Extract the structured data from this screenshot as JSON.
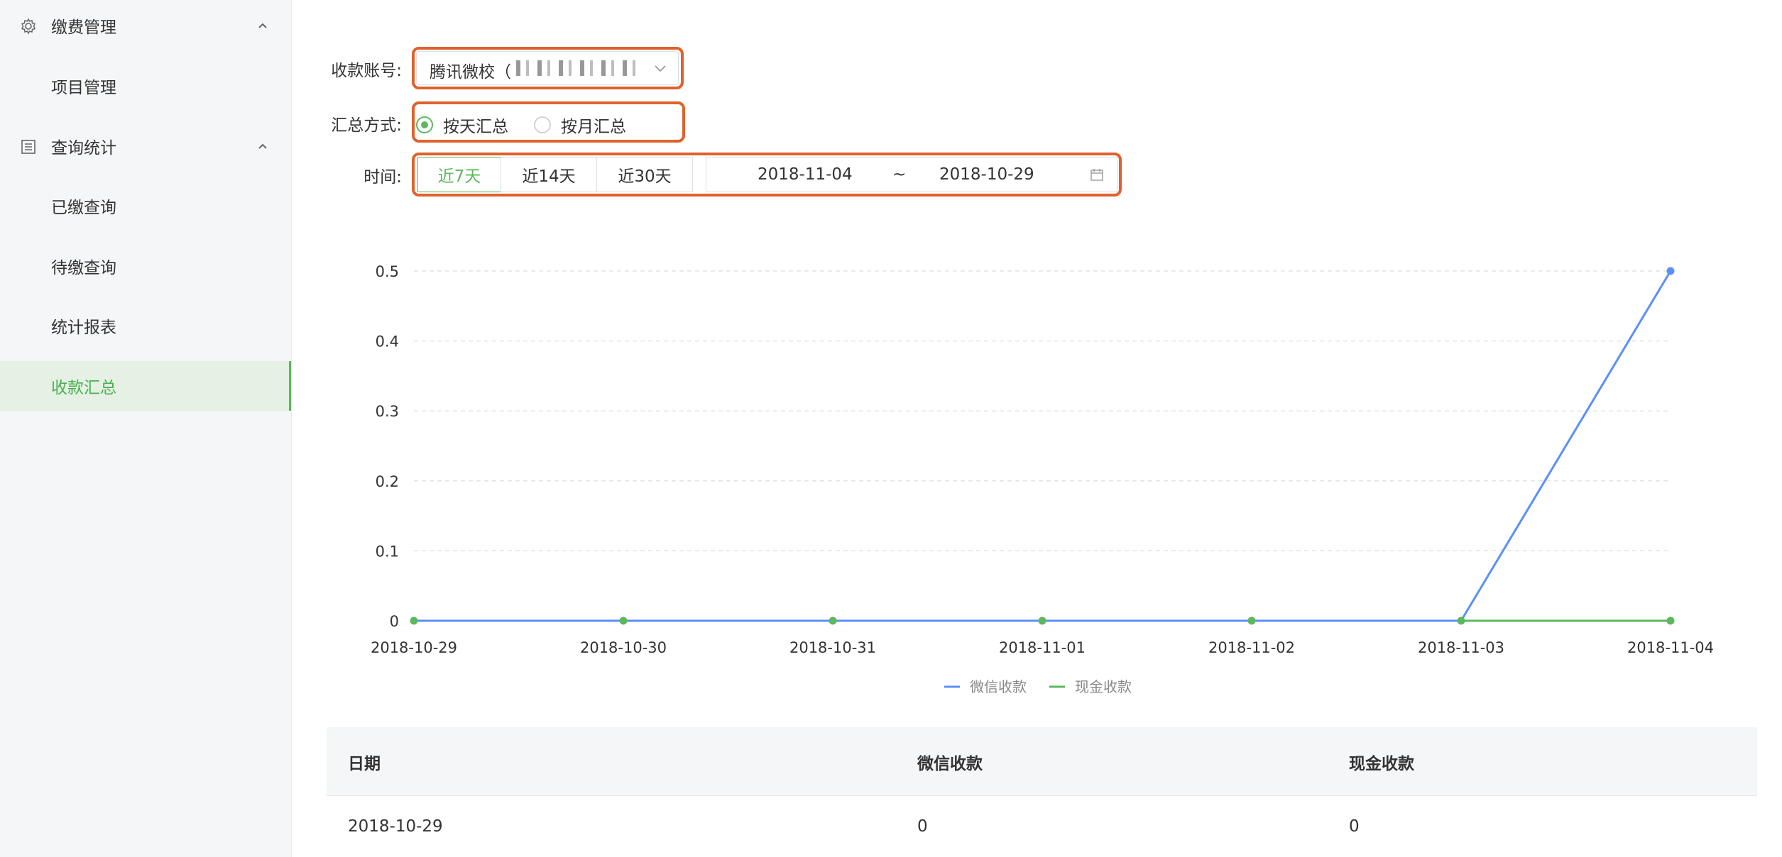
{
  "sidebar": {
    "groups": [
      {
        "label": "缴费管理",
        "items": [
          {
            "label": "项目管理"
          }
        ]
      },
      {
        "label": "查询统计",
        "items": [
          {
            "label": "已缴查询"
          },
          {
            "label": "待缴查询"
          },
          {
            "label": "统计报表"
          },
          {
            "label": "收款汇总",
            "active": true
          }
        ]
      }
    ]
  },
  "form": {
    "account_label": "收款账号:",
    "account_value": "腾讯微校（",
    "summary_label": "汇总方式:",
    "summary_options": [
      {
        "label": "按天汇总",
        "checked": true
      },
      {
        "label": "按月汇总",
        "checked": false
      }
    ],
    "time_label": "时间:",
    "time_presets": [
      {
        "label": "近7天",
        "active": true
      },
      {
        "label": "近14天"
      },
      {
        "label": "近30天"
      }
    ],
    "range_start": "2018-11-04",
    "range_sep": "~",
    "range_end": "2018-10-29"
  },
  "colors": {
    "accent": "#5cb85c",
    "wechat": "#5b8ff9",
    "cash": "#5cb85c",
    "highlight": "#e0612b"
  },
  "chart_data": {
    "type": "line",
    "categories": [
      "2018-10-29",
      "2018-10-30",
      "2018-10-31",
      "2018-11-01",
      "2018-11-02",
      "2018-11-03",
      "2018-11-04"
    ],
    "series": [
      {
        "name": "微信收款",
        "values": [
          0,
          0,
          0,
          0,
          0,
          0,
          0.5
        ]
      },
      {
        "name": "现金收款",
        "values": [
          0,
          0,
          0,
          0,
          0,
          0,
          0
        ]
      }
    ],
    "yticks": [
      "0",
      "0.1",
      "0.2",
      "0.3",
      "0.4",
      "0.5"
    ],
    "ylim": [
      0,
      0.5
    ],
    "legend": "bottom",
    "grid": true
  },
  "table": {
    "headers": [
      "日期",
      "微信收款",
      "现金收款"
    ],
    "rows": [
      [
        "2018-10-29",
        "0",
        "0"
      ]
    ]
  }
}
